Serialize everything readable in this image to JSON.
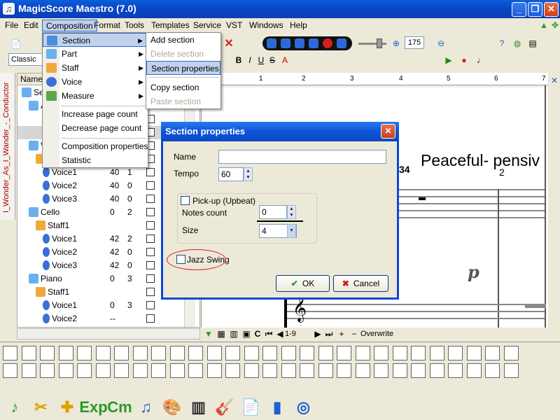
{
  "window": {
    "title": "MagicScore Maestro (7.0)",
    "controls": {
      "minimize": "_",
      "maximize": "❐",
      "close": "✕"
    }
  },
  "menubar": [
    "File",
    "Edit",
    "Composition",
    "Format",
    "Tools",
    "Templates",
    "Service",
    "VST",
    "Windows",
    "Help"
  ],
  "toolbar": {
    "style_select": "Classic",
    "zoom_value": "175",
    "overwrite_label": "Overwrite",
    "page_label": "1-9"
  },
  "composition_menu": {
    "items": [
      {
        "label": "Section",
        "submenu": true
      },
      {
        "label": "Part",
        "submenu": true
      },
      {
        "label": "Staff",
        "submenu": true
      },
      {
        "label": "Voice",
        "submenu": true
      },
      {
        "label": "Measure",
        "submenu": true
      },
      {
        "label": "Increase page count"
      },
      {
        "label": "Decrease page count"
      },
      {
        "label": "Composition properties"
      },
      {
        "label": "Statistic"
      }
    ]
  },
  "section_submenu": {
    "items": [
      {
        "label": "Add section",
        "disabled": false
      },
      {
        "label": "Delete section",
        "disabled": true
      },
      {
        "label": "Section properties",
        "disabled": false
      },
      {
        "label": "Copy section",
        "disabled": false
      },
      {
        "label": "Paste section",
        "disabled": true
      }
    ]
  },
  "conductor_tab": "I_Wonder_As_I_Wander_-_Conductor",
  "tree": {
    "header": "Name",
    "rows": [
      {
        "name": "Se",
        "indent": 1,
        "icon": "part",
        "c1": "",
        "c2": ""
      },
      {
        "name": "A",
        "indent": 2,
        "icon": "part",
        "c1": "",
        "c2": ""
      },
      {
        "name": "",
        "indent": 3,
        "icon": "",
        "c1": "",
        "c2": ""
      },
      {
        "name": "",
        "indent": 3,
        "icon": "",
        "c1": "",
        "c2": ""
      },
      {
        "name": "V",
        "indent": 2,
        "icon": "part",
        "c1": "",
        "c2": ""
      },
      {
        "name": "",
        "indent": 3,
        "icon": "staff",
        "c1": "",
        "c2": ""
      },
      {
        "name": "Voice1",
        "indent": 4,
        "icon": "voice",
        "c1": "40",
        "c2": "1"
      },
      {
        "name": "Voice2",
        "indent": 4,
        "icon": "voice",
        "c1": "40",
        "c2": "0"
      },
      {
        "name": "Voice3",
        "indent": 4,
        "icon": "voice",
        "c1": "40",
        "c2": "0"
      },
      {
        "name": "Cello",
        "indent": 2,
        "icon": "part",
        "c1": "0",
        "c2": "2"
      },
      {
        "name": "Staff1",
        "indent": 3,
        "icon": "staff",
        "c1": "",
        "c2": ""
      },
      {
        "name": "Voice1",
        "indent": 4,
        "icon": "voice",
        "c1": "42",
        "c2": "2"
      },
      {
        "name": "Voice2",
        "indent": 4,
        "icon": "voice",
        "c1": "42",
        "c2": "0"
      },
      {
        "name": "Voice3",
        "indent": 4,
        "icon": "voice",
        "c1": "42",
        "c2": "0"
      },
      {
        "name": "Piano",
        "indent": 2,
        "icon": "part",
        "c1": "0",
        "c2": "3"
      },
      {
        "name": "Staff1",
        "indent": 3,
        "icon": "staff",
        "c1": "",
        "c2": ""
      },
      {
        "name": "Voice1",
        "indent": 4,
        "icon": "voice",
        "c1": "0",
        "c2": "3"
      },
      {
        "name": "Voice2",
        "indent": 4,
        "icon": "voice",
        "c1": "--",
        "c2": ""
      }
    ]
  },
  "score": {
    "title_text": "Peaceful- pensiv",
    "time_sig": "34",
    "measure_number": "2",
    "dynamic": "p",
    "ruler_numbers": [
      "1",
      "2",
      "3",
      "4",
      "5",
      "6",
      "7"
    ]
  },
  "dialog": {
    "title": "Section properties",
    "name_label": "Name",
    "name_value": "",
    "tempo_label": "Tempo",
    "tempo_value": "60",
    "pickup_label": "Pick-up (Upbeat)",
    "pickup_checked": false,
    "notes_count_label": "Notes count",
    "notes_count_value": "0",
    "size_label": "Size",
    "size_value": "4",
    "jazz_label": "Jazz Swing",
    "jazz_checked": false,
    "ok_label": "OK",
    "cancel_label": "Cancel"
  },
  "bottom_icons": [
    "♪",
    "✂",
    "✚",
    "Exp",
    "Cm",
    "♫",
    "🎨",
    "▥",
    "🎸",
    "📄",
    "▮",
    "◎"
  ],
  "colors": {
    "titlebar": "#0a47c9",
    "menu_highlight": "#c1d2ee",
    "highlight_border": "#316ac5",
    "jazz_oval": "#d42020"
  }
}
